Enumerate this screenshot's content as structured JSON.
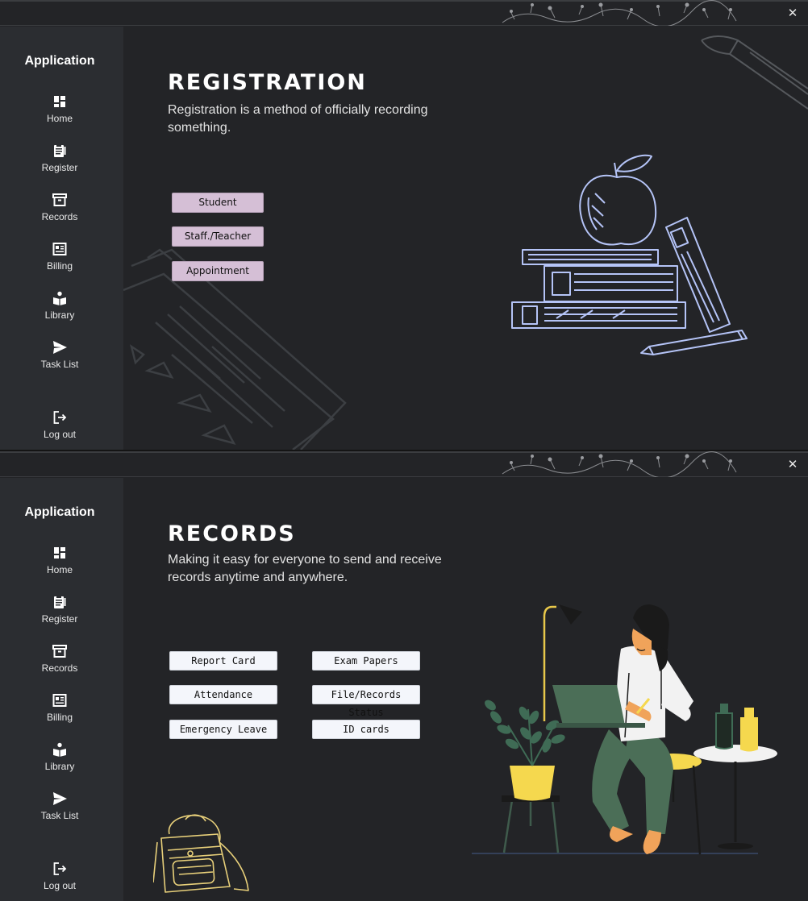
{
  "colors": {
    "window_bg": "#232427",
    "sidebar_bg": "#2b2d31",
    "lilac_button": "#d5bfd6",
    "white_button": "#f4f6fb",
    "sketch_blue": "#b5c4f7",
    "sketch_yellow": "#e8d07a"
  },
  "window_registration": {
    "close_glyph": "✕",
    "sidebar": {
      "title": "Application",
      "items": [
        {
          "label": "Home",
          "icon": "dashboard-icon"
        },
        {
          "label": "Register",
          "icon": "clipboard-icon"
        },
        {
          "label": "Records",
          "icon": "archive-icon"
        },
        {
          "label": "Billing",
          "icon": "receipt-icon"
        },
        {
          "label": "Library",
          "icon": "book-reader-icon"
        },
        {
          "label": "Task List",
          "icon": "send-icon"
        },
        {
          "label": "Log out",
          "icon": "logout-icon"
        }
      ]
    },
    "main": {
      "title": "REGISTRATION",
      "description": "Registration is a method of officially recording something.",
      "buttons": [
        "Student",
        "Staff./Teacher",
        "Appointment"
      ]
    }
  },
  "window_records": {
    "close_glyph": "✕",
    "sidebar": {
      "title": "Application",
      "items": [
        {
          "label": "Home",
          "icon": "dashboard-icon"
        },
        {
          "label": "Register",
          "icon": "clipboard-icon"
        },
        {
          "label": "Records",
          "icon": "archive-icon"
        },
        {
          "label": "Billing",
          "icon": "receipt-icon"
        },
        {
          "label": "Library",
          "icon": "book-reader-icon"
        },
        {
          "label": "Task List",
          "icon": "send-icon"
        },
        {
          "label": "Log out",
          "icon": "logout-icon"
        }
      ]
    },
    "main": {
      "title": "RECORDS",
      "description": "Making it easy for everyone to send and receive records anytime and anywhere.",
      "buttons": [
        "Report Card",
        "Exam Papers",
        "Attendance",
        "File/Records Status",
        "Emergency Leave",
        "ID cards"
      ]
    }
  }
}
